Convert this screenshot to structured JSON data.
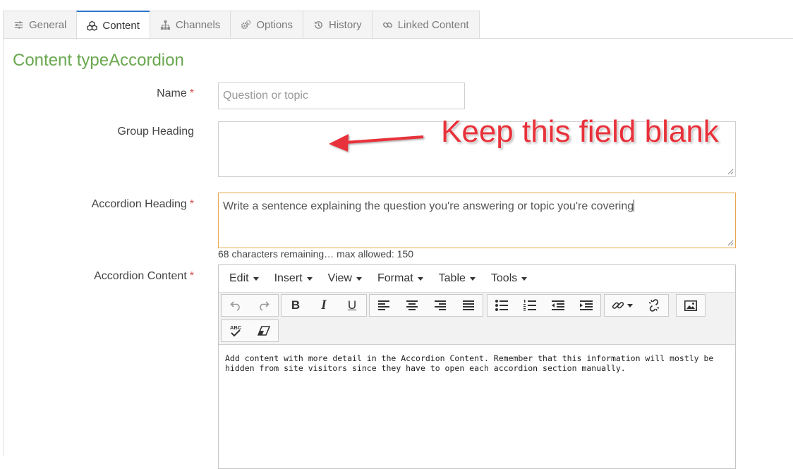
{
  "tabs": [
    {
      "label": "General",
      "icon": "sliders-icon",
      "active": false
    },
    {
      "label": "Content",
      "icon": "cubes-icon",
      "active": true
    },
    {
      "label": "Channels",
      "icon": "sitemap-icon",
      "active": false
    },
    {
      "label": "Options",
      "icon": "cogs-icon",
      "active": false
    },
    {
      "label": "History",
      "icon": "history-icon",
      "active": false
    },
    {
      "label": "Linked Content",
      "icon": "link-icon",
      "active": false
    }
  ],
  "page": {
    "title": "Content typeAccordion"
  },
  "form": {
    "name_label": "Name",
    "name_placeholder": "Question or topic",
    "group_heading_label": "Group Heading",
    "group_heading_value": "",
    "accordion_heading_label": "Accordion Heading",
    "accordion_heading_value": "Write a sentence explaining the question you're answering or topic you're covering",
    "counter_text": "68 characters remaining… max allowed: 150",
    "accordion_content_label": "Accordion Content",
    "required_mark": "*"
  },
  "editor": {
    "menus": [
      "Edit",
      "Insert",
      "View",
      "Format",
      "Table",
      "Tools"
    ],
    "bold": "B",
    "italic": "I",
    "underline": "U",
    "spellcheck": "ABC",
    "content": "Add content with more detail in the Accordion Content. Remember that this information will mostly be hidden from site visitors since they have to open each accordion section manually."
  },
  "annotation": {
    "text": "Keep this field blank",
    "color": "#e8313a"
  },
  "colors": {
    "title": "#6aa84f",
    "active_tab": "#2b77c8",
    "required": "#d9534f",
    "focus_border": "#e8a84c"
  }
}
